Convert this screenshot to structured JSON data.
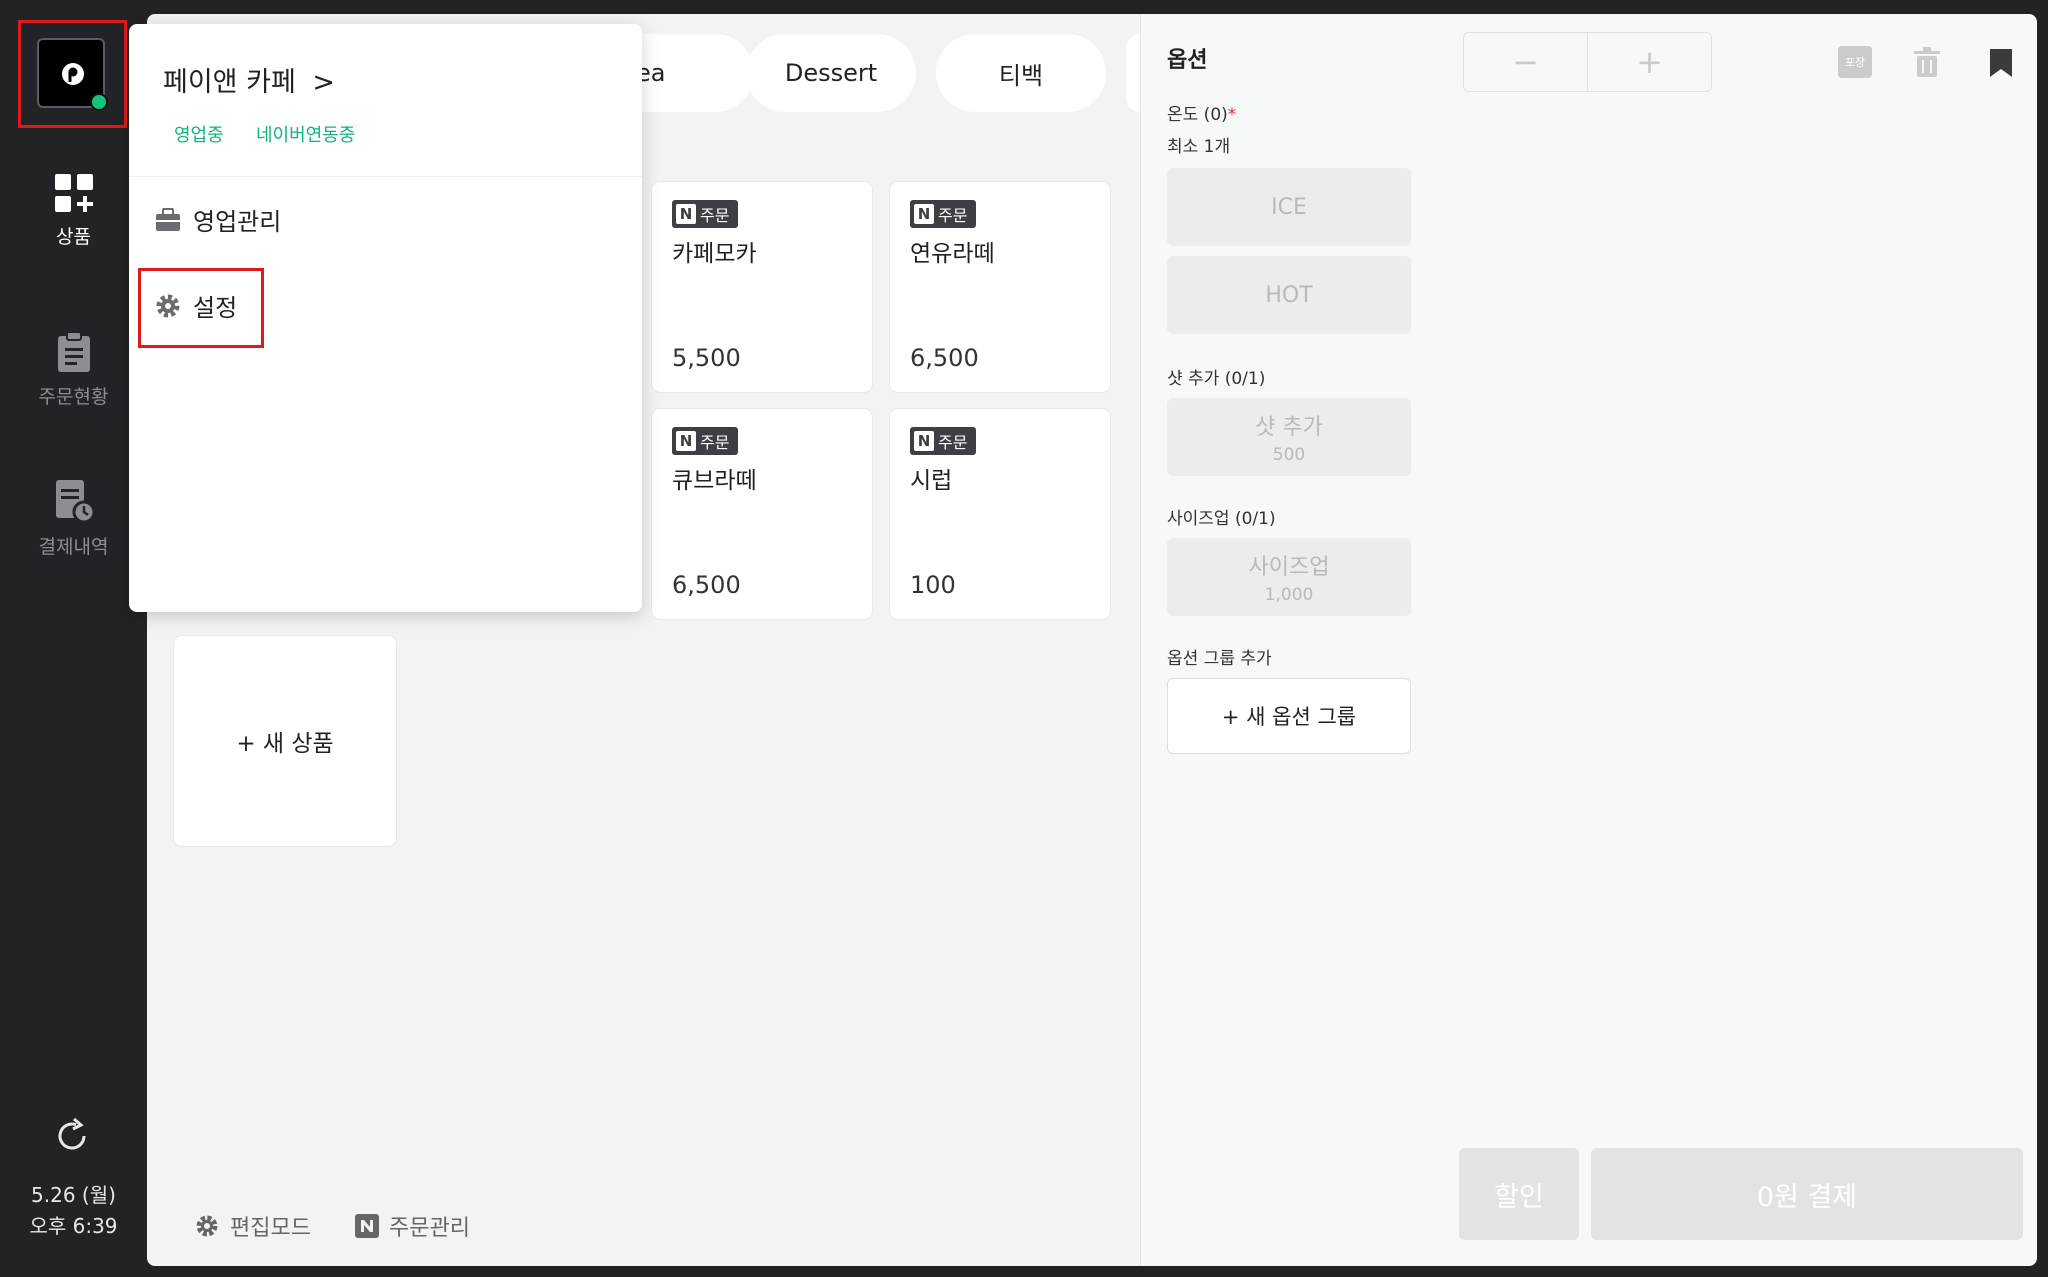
{
  "sidebar": {
    "nav": [
      {
        "label": "상품",
        "icon": "grid-plus-icon"
      },
      {
        "label": "주문현황",
        "icon": "clipboard-icon"
      },
      {
        "label": "결제내역",
        "icon": "receipt-clock-icon"
      }
    ],
    "clock": {
      "date": "5.26 (월)",
      "time": "오후 6:39"
    },
    "status_color": "#16c37a"
  },
  "categories": [
    "ea",
    "Dessert",
    "티백"
  ],
  "products": [
    {
      "badge": "주문",
      "name": "카페모카",
      "price": "5,500"
    },
    {
      "badge": "주문",
      "name": "연유라떼",
      "price": "6,500"
    },
    {
      "badge": "주문",
      "name": "큐브라떼",
      "price": "6,500"
    },
    {
      "badge": "주문",
      "name": "시럽",
      "price": "100"
    }
  ],
  "new_product_label": "+ 새 상품",
  "footer": {
    "edit_mode": "편집모드",
    "order_mgmt": "주문관리"
  },
  "options": {
    "title": "옵션",
    "temperature": {
      "label": "온도 (0)",
      "required": "*",
      "min": "최소 1개",
      "choices": [
        "ICE",
        "HOT"
      ]
    },
    "shot": {
      "label": "샷 추가 (0/1)",
      "name": "샷 추가",
      "price": "500"
    },
    "size": {
      "label": "사이즈업 (0/1)",
      "name": "사이즈업",
      "price": "1,000"
    },
    "group_label": "옵션 그룹 추가",
    "new_group": "+ 새 옵션 그룹"
  },
  "cart": {
    "minus": "−",
    "plus": "+",
    "pack": "포장",
    "discount": "할인",
    "pay": "0원 결제"
  },
  "popup": {
    "store_name": "페이앤 카페",
    "chevron": ">",
    "tags": [
      "영업중",
      "네이버연동중"
    ],
    "menu": [
      "영업관리",
      "설정"
    ],
    "accent": "#10b47a"
  },
  "highlight_color": "#e0191d"
}
